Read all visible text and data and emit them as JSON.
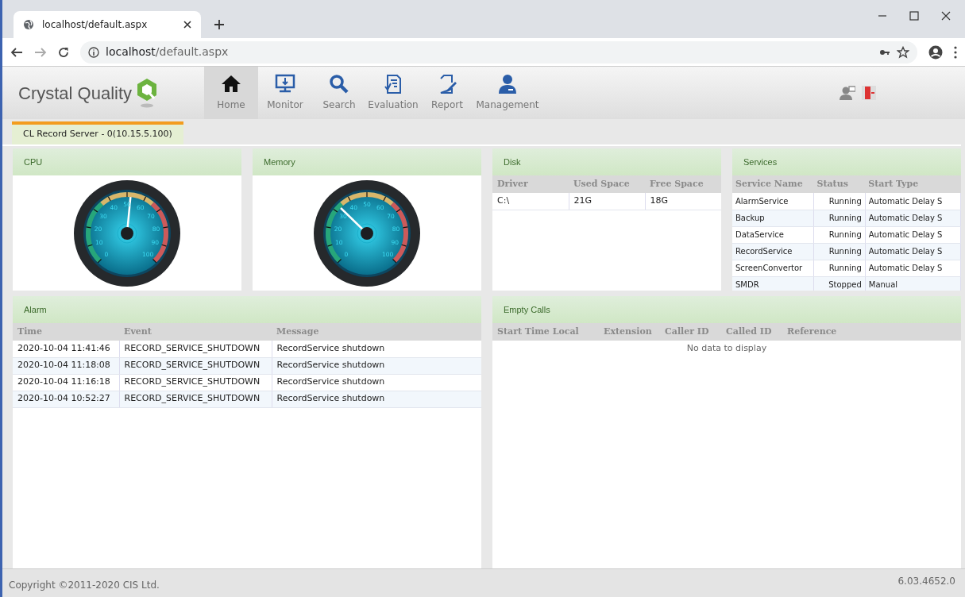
{
  "browser": {
    "tab_title": "localhost/default.aspx",
    "url_host": "localhost",
    "url_path": "/default.aspx"
  },
  "app": {
    "logo_text": "Crystal Quality",
    "nav": [
      {
        "label": "Home",
        "selected": true
      },
      {
        "label": "Monitor",
        "selected": false
      },
      {
        "label": "Search",
        "selected": false
      },
      {
        "label": "Evaluation",
        "selected": false
      },
      {
        "label": "Report",
        "selected": false
      },
      {
        "label": "Management",
        "selected": false
      }
    ]
  },
  "server_tabs": [
    {
      "label": "CL Record Server - 0(10.15.5.100)",
      "selected": true
    }
  ],
  "gauges": [
    {
      "title": "CPU",
      "level": 0.52,
      "scale_labels": [
        "0",
        "10",
        "20",
        "30",
        "40",
        "50",
        "60",
        "70",
        "80",
        "90",
        "100"
      ]
    },
    {
      "title": "Memory",
      "level": 0.33,
      "scale_labels": [
        "0",
        "10",
        "20",
        "30",
        "40",
        "50",
        "60",
        "70",
        "80",
        "90",
        "100"
      ]
    }
  ],
  "disk": {
    "title": "Disk",
    "columns": [
      "Driver",
      "Used Space",
      "Free Space"
    ],
    "rows": [
      [
        "C:\\",
        "21G",
        "18G"
      ]
    ]
  },
  "services": {
    "title": "Services",
    "columns": [
      "Service Name",
      "Status",
      "Start Type"
    ],
    "rows": [
      [
        "AlarmService",
        "Running",
        "Automatic Delay S"
      ],
      [
        "Backup",
        "Running",
        "Automatic Delay S"
      ],
      [
        "DataService",
        "Running",
        "Automatic Delay S"
      ],
      [
        "RecordService",
        "Running",
        "Automatic Delay S"
      ],
      [
        "ScreenConvertor",
        "Running",
        "Automatic Delay S"
      ],
      [
        "SMDR",
        "Stopped",
        "Manual"
      ]
    ]
  },
  "alarm": {
    "title": "Alarm",
    "columns": [
      "Time",
      "Event",
      "Message"
    ],
    "rows": [
      [
        "2020-10-04 11:41:46",
        "RECORD_SERVICE_SHUTDOWN",
        "RecordService shutdown"
      ],
      [
        "2020-10-04 11:18:08",
        "RECORD_SERVICE_SHUTDOWN",
        "RecordService shutdown"
      ],
      [
        "2020-10-04 11:16:18",
        "RECORD_SERVICE_SHUTDOWN",
        "RecordService shutdown"
      ],
      [
        "2020-10-04 10:52:27",
        "RECORD_SERVICE_SHUTDOWN",
        "RecordService shutdown"
      ]
    ]
  },
  "empty_calls": {
    "title": "Empty Calls",
    "columns": [
      "Start Time Local",
      "Extension",
      "Caller ID",
      "Called ID",
      "Reference"
    ],
    "empty_text": "No data to display"
  },
  "footer": {
    "copyright": "Copyright ©2011-2020 CIS Ltd.",
    "version": "6.03.4652.0"
  }
}
